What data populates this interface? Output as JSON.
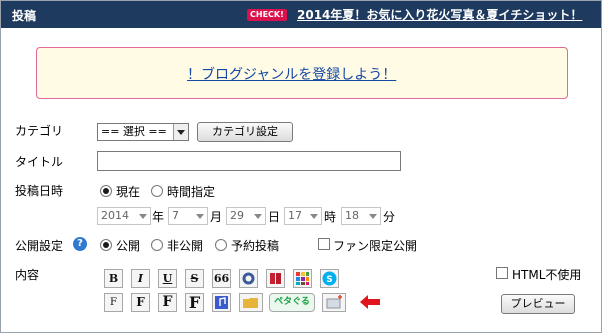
{
  "header": {
    "title": "投稿",
    "check_badge": "CHECK!",
    "promo_link": "2014年夏！お気に入り花火写真＆夏イチショット！"
  },
  "banner": {
    "link": "！ブログジャンルを登録しよう！"
  },
  "form": {
    "category": {
      "label": "カテゴリ",
      "selected": "== 選択 ==",
      "settings_button": "カテゴリ設定"
    },
    "title": {
      "label": "タイトル",
      "value": ""
    },
    "datetime": {
      "label": "投稿日時",
      "opt_now": "現在",
      "opt_specify": "時間指定",
      "year": "2014",
      "month": "7",
      "day": "29",
      "hour": "17",
      "minute": "18",
      "unit_year": "年",
      "unit_month": "月",
      "unit_day": "日",
      "unit_hour": "時",
      "unit_minute": "分"
    },
    "visibility": {
      "label": "公開設定",
      "help": "?",
      "opt_public": "公開",
      "opt_private": "非公開",
      "opt_scheduled": "予約投稿",
      "fan_only": "ファン限定公開"
    },
    "content": {
      "label": "内容",
      "html_off": "HTML不使用",
      "preview_button": "プレビュー",
      "toolbar_row1": [
        "B",
        "I",
        "U",
        "S",
        "66"
      ],
      "toolbar_row2": [
        "F",
        "F",
        "F",
        "F"
      ],
      "petadeco": "ペタぐる"
    }
  }
}
